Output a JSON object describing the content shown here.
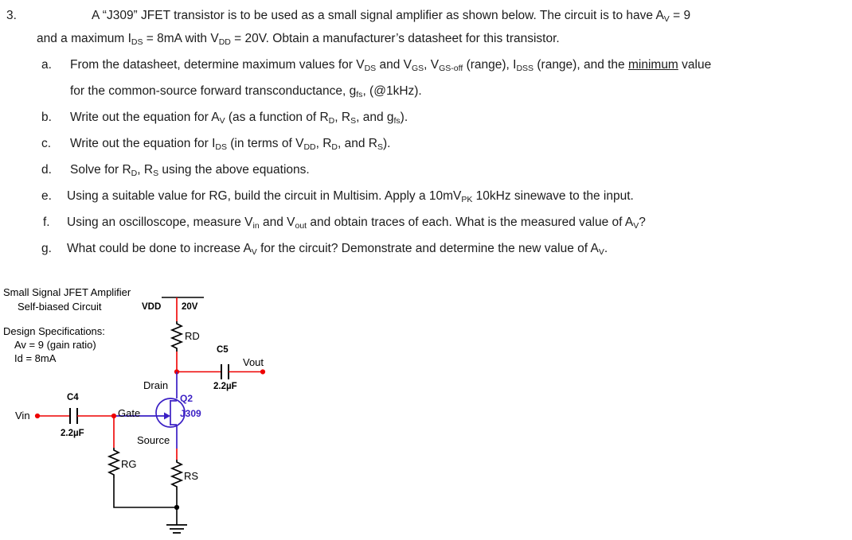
{
  "question": {
    "number": "3.",
    "intro_line1_pre": "A “J309” JFET transistor is to be used as a small signal amplifier as shown below.  The circuit is to have A",
    "intro_line1_sub": "V",
    "intro_line1_post": " = 9",
    "intro_line2_a": "and a maximum I",
    "intro_line2_sub1": "DS",
    "intro_line2_b": " = 8mA with V",
    "intro_line2_sub2": "DD",
    "intro_line2_c": " = 20V.  Obtain a manufacturer’s datasheet for this transistor.",
    "items": [
      {
        "letter": "a.",
        "line1_p1": "From the datasheet, determine maximum values for V",
        "line1_s1": "DS",
        "line1_p2": " and V",
        "line1_s2": "GS",
        "line1_p3": ", V",
        "line1_s3": "GS-off",
        "line1_p4": " (range), I",
        "line1_s4": "DSS",
        "line1_p5": " (range), and the ",
        "line1_underline": "minimum",
        "line1_p6": " value",
        "line2_p1": "for the common-source forward transconductance, g",
        "line2_s1": "fs",
        "line2_p2": ", (@1kHz)."
      },
      {
        "letter": "b.",
        "line1_p1": "Write out the equation for A",
        "line1_s1": "V",
        "line1_p2": " (as a function of R",
        "line1_s2": "D",
        "line1_p3": ", R",
        "line1_s3": "S",
        "line1_p4": ", and g",
        "line1_s4": "fs",
        "line1_p5": ")."
      },
      {
        "letter": "c.",
        "line1_p1": "Write out the equation for I",
        "line1_s1": "DS",
        "line1_p2": " (in terms of V",
        "line1_s2": "DD",
        "line1_p3": ", R",
        "line1_s3": "D",
        "line1_p4": ", and R",
        "line1_s4": "S",
        "line1_p5": ")."
      },
      {
        "letter": "d.",
        "line1_p1": "Solve for R",
        "line1_s1": "D",
        "line1_p2": ", R",
        "line1_s2": "S",
        "line1_p3": " using the above equations."
      },
      {
        "letter": "e.",
        "line1_p1": "Using a suitable value for RG, build the circuit in Multisim. Apply a 10mV",
        "line1_s1": "PK",
        "line1_p2": " 10kHz sinewave to the input."
      },
      {
        "letter": "f.",
        "line1_p1": "Using an oscilloscope, measure V",
        "line1_s1": "in",
        "line1_p2": " and V",
        "line1_s2": "out",
        "line1_p3": " and obtain traces of each.  What is the measured value of A",
        "line1_s3": "V",
        "line1_p4": "?"
      },
      {
        "letter": "g.",
        "line1_p1": "What could be done to increase A",
        "line1_s1": "V",
        "line1_p2": " for the circuit?  Demonstrate and determine the new value of A",
        "line1_s2": "V",
        "line1_p3": "."
      }
    ]
  },
  "schematic": {
    "title_line1": "Small Signal JFET Amplifier",
    "title_line2": "Self-biased Circuit",
    "spec_heading": "Design Specifications:",
    "spec_av": "Av = 9 (gain ratio)",
    "spec_id": "Id  = 8mA",
    "vdd_label": "VDD",
    "vdd_value": "20V",
    "rd_label": "RD",
    "rs_label": "RS",
    "rg_label": "RG",
    "c4_label": "C4",
    "c4_value": "2.2µF",
    "c5_label": "C5",
    "c5_value": "2.2µF",
    "vin_label": "Vin",
    "vout_label": "Vout",
    "drain_label": "Drain",
    "gate_label": "Gate",
    "source_label": "Source",
    "q_ref": "Q2",
    "q_part": "J309",
    "colors": {
      "wire_red": "#ee0000",
      "wire_black": "#000000",
      "device_purple": "#3a1fc4",
      "text_black": "#000000"
    }
  }
}
